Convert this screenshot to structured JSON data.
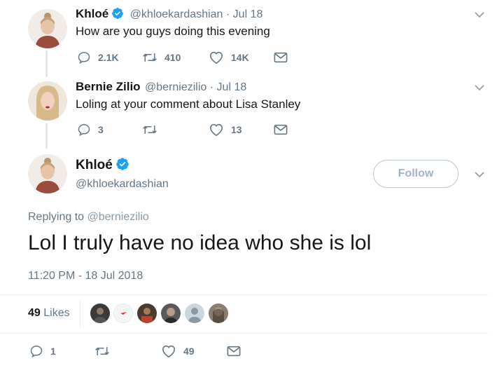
{
  "tweets": [
    {
      "name": "Khloé",
      "handle": "@khloekardashian",
      "date": "· Jul 18",
      "text": "How are you guys doing this evening",
      "replies": "2.1K",
      "retweets": "410",
      "likes": "14K"
    },
    {
      "name": "Bernie Zilio",
      "handle": "@berniezilio",
      "date": "· Jul 18",
      "text": "Loling at your comment about Lisa Stanley",
      "replies": "3",
      "retweets": "",
      "likes": "13"
    }
  ],
  "main": {
    "name": "Khloé",
    "handle": "@khloekardashian",
    "follow_label": "Follow",
    "replying_prefix": "Replying to",
    "replying_to": "@berniezilio",
    "text": "Lol I truly have no idea who she is lol",
    "timestamp": "11:20 PM - 18 Jul 2018",
    "likes_count": "49",
    "likes_label": "Likes",
    "actions": {
      "replies": "1",
      "retweets": "",
      "likes": "49"
    }
  },
  "colors": {
    "verified": "#1da1f2",
    "icon": "#657786",
    "text": "#14171a",
    "muted": "#657786"
  }
}
